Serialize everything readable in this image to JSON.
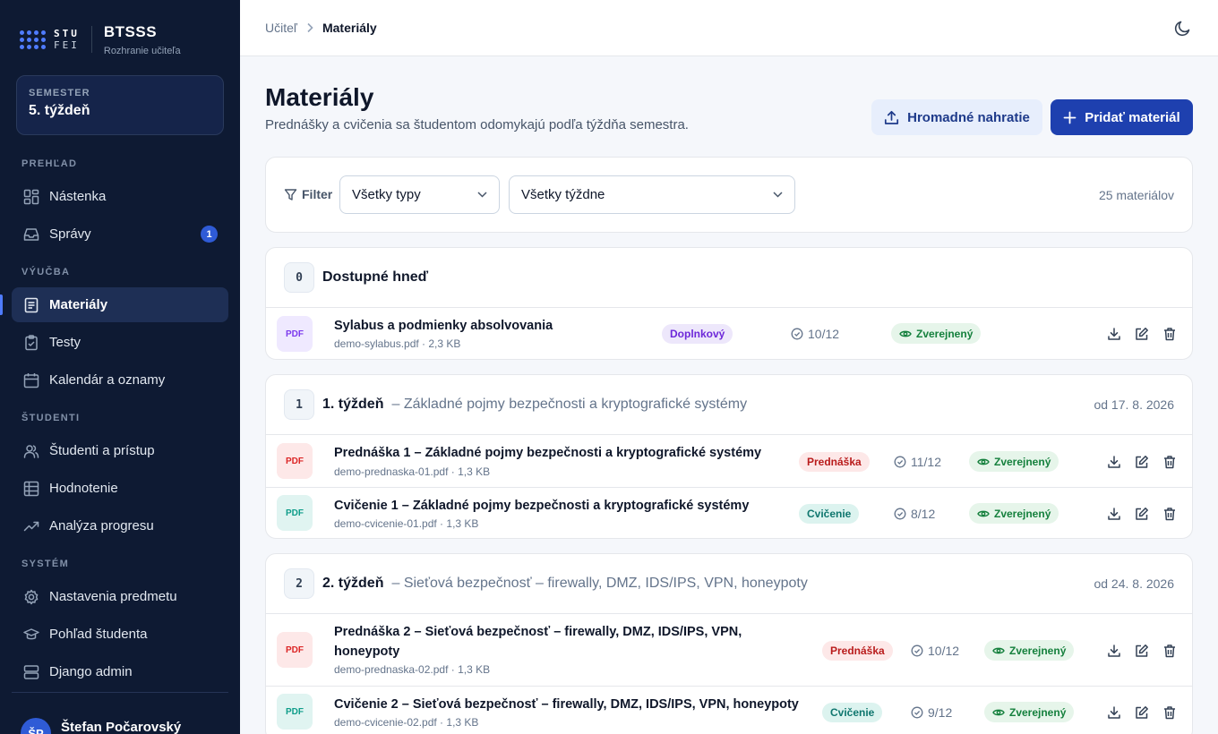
{
  "brand": {
    "logo_line1": "STU",
    "logo_line2": "FEI",
    "title": "BTSSS",
    "subtitle": "Rozhranie učiteľa"
  },
  "semester": {
    "label": "SEMESTER",
    "value": "5. týždeň"
  },
  "nav": {
    "sections": [
      "PREHĽAD",
      "VÝUČBA",
      "ŠTUDENTI",
      "SYSTÉM"
    ],
    "items": [
      {
        "label": "Nástenka",
        "icon": "dashboard-icon"
      },
      {
        "label": "Správy",
        "icon": "inbox-icon",
        "badge": "1"
      },
      {
        "label": "Materiály",
        "icon": "document-icon",
        "active": true
      },
      {
        "label": "Testy",
        "icon": "clipboard-check-icon"
      },
      {
        "label": "Kalendár a oznamy",
        "icon": "calendar-icon"
      },
      {
        "label": "Študenti a prístup",
        "icon": "users-icon"
      },
      {
        "label": "Hodnotenie",
        "icon": "table-icon"
      },
      {
        "label": "Analýza progresu",
        "icon": "trending-up-icon"
      },
      {
        "label": "Nastavenia predmetu",
        "icon": "gear-icon"
      },
      {
        "label": "Pohľad študenta",
        "icon": "graduation-cap-icon"
      },
      {
        "label": "Django admin",
        "icon": "server-icon"
      }
    ]
  },
  "user": {
    "initials": "ŠP",
    "name": "Štefan Počarovský"
  },
  "breadcrumb": {
    "parent": "Učiteľ",
    "current": "Materiály"
  },
  "page": {
    "title": "Materiály",
    "subtitle": "Prednášky a cvičenia sa študentom odomykajú podľa týždňa semestra.",
    "bulk_button": "Hromadné nahratie",
    "add_button": "Pridať materiál"
  },
  "filter": {
    "label": "Filter",
    "type_select": "Všetky typy",
    "week_select": "Všetky týždne",
    "count": "25 materiálov"
  },
  "groups": [
    {
      "week": "0",
      "title": "Dostupné hneď",
      "subtitle": "",
      "date": "",
      "rows": [
        {
          "icon_label": "PDF",
          "title": "Sylabus a podmienky absolvovania",
          "meta": "demo-sylabus.pdf · 2,3 KB",
          "tag": "Doplnkový",
          "score": "10/12",
          "status": "Zverejnený"
        }
      ]
    },
    {
      "week": "1",
      "title": "1. týždeň",
      "subtitle": "– Základné pojmy bezpečnosti a kryptografické systémy",
      "date": "od 17. 8. 2026",
      "rows": [
        {
          "icon_label": "PDF",
          "title": "Prednáška 1 – Základné pojmy bezpečnosti a kryptografické systémy",
          "meta": "demo-prednaska-01.pdf · 1,3 KB",
          "tag": "Prednáška",
          "score": "11/12",
          "status": "Zverejnený"
        },
        {
          "icon_label": "PDF",
          "title": "Cvičenie 1 – Základné pojmy bezpečnosti a kryptografické systémy",
          "meta": "demo-cvicenie-01.pdf · 1,3 KB",
          "tag": "Cvičenie",
          "score": "8/12",
          "status": "Zverejnený"
        }
      ]
    },
    {
      "week": "2",
      "title": "2. týždeň",
      "subtitle": "– Sieťová bezpečnosť – firewally, DMZ, IDS/IPS, VPN, honeypoty",
      "date": "od 24. 8. 2026",
      "rows": [
        {
          "icon_label": "PDF",
          "title_line1": "Prednáška 2 – Sieťová bezpečnosť – firewally, DMZ, IDS/IPS, VPN,",
          "title_line2": "honeypoty",
          "meta": "demo-prednaska-02.pdf · 1,3 KB",
          "tag": "Prednáška",
          "score": "10/12",
          "status": "Zverejnený"
        },
        {
          "icon_label": "PDF",
          "title": "Cvičenie 2 – Sieťová bezpečnosť – firewally, DMZ, IDS/IPS, VPN, honeypoty",
          "meta": "demo-cvicenie-02.pdf · 1,3 KB",
          "tag": "Cvičenie",
          "score": "9/12",
          "status": "Zverejnený"
        }
      ]
    }
  ],
  "colors": {
    "sidebar_bg": "#0e1a33",
    "primary": "#1e40af",
    "accent": "#4f7cff",
    "published": "#15803d"
  }
}
